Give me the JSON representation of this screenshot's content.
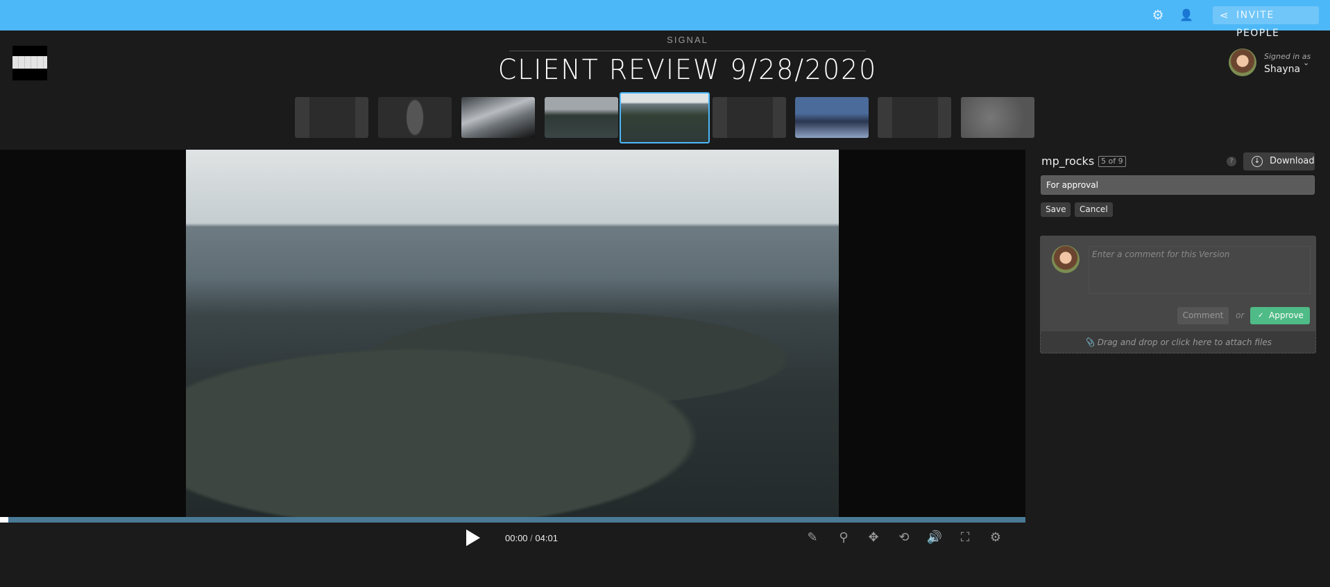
{
  "topbar": {
    "invite_label": "INVITE PEOPLE",
    "accent": "#4db8f8"
  },
  "header": {
    "project": "SIGNAL",
    "title": "CLIENT REVIEW 9/28/2020"
  },
  "user": {
    "signed_in_label": "Signed in as",
    "name": "Shayna"
  },
  "thumbnails": {
    "count": 9,
    "selected_index": 4
  },
  "player": {
    "time_current": "00:00",
    "time_total": "04:01",
    "progress": 0.0
  },
  "version": {
    "name": "mp_rocks",
    "count": "5 of 9",
    "help": "?",
    "download_label": "Download",
    "status_value": "For approval",
    "save_label": "Save",
    "cancel_label": "Cancel"
  },
  "comment": {
    "placeholder": "Enter a comment for this Version",
    "comment_label": "Comment",
    "or_label": "or",
    "approve_label": "Approve",
    "attach_label": "Drag and drop or click here to attach files",
    "approve_color": "#4fbb86"
  }
}
